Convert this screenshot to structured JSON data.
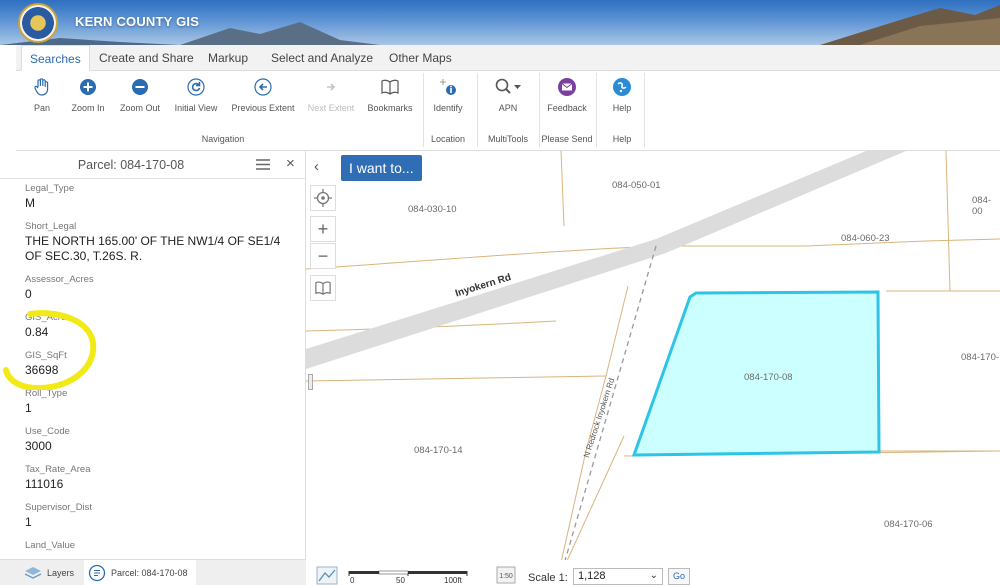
{
  "app": {
    "title": "KERN COUNTY GIS"
  },
  "tabs": [
    {
      "label": "Searches",
      "active": true
    },
    {
      "label": "Create and Share"
    },
    {
      "label": "Markup"
    },
    {
      "label": "Select and Analyze"
    },
    {
      "label": "Other Maps"
    }
  ],
  "ribbon": {
    "tools": {
      "pan": "Pan",
      "zoom_in": "Zoom In",
      "zoom_out": "Zoom Out",
      "initial_view": "Initial View",
      "previous_extent": "Previous Extent",
      "next_extent": "Next Extent",
      "bookmarks": "Bookmarks",
      "identify": "Identify",
      "apn": "APN",
      "feedback": "Feedback",
      "help": "Help"
    },
    "groups": {
      "navigation": "Navigation",
      "location": "Location",
      "multitools": "MultiTools",
      "please_send": "Please Send",
      "help": "Help"
    }
  },
  "panel": {
    "title": "Parcel: 084-170-08",
    "attributes": [
      {
        "key": "Legal_Type",
        "value": "M"
      },
      {
        "key": "Short_Legal",
        "value": "THE NORTH 165.00' OF THE NW1/4 OF SE1/4 OF SEC.30, T.26S. R."
      },
      {
        "key": "Assessor_Acres",
        "value": "0"
      },
      {
        "key": "GIS_Acres",
        "value": "0.84"
      },
      {
        "key": "GIS_SqFt",
        "value": "36698"
      },
      {
        "key": "Roll_Type",
        "value": "1"
      },
      {
        "key": "Use_Code",
        "value": "3000"
      },
      {
        "key": "Tax_Rate_Area",
        "value": "111016"
      },
      {
        "key": "Supervisor_Dist",
        "value": "1"
      },
      {
        "key": "Land_Value",
        "value": ""
      }
    ],
    "footer": {
      "layers": "Layers",
      "parcel": "Parcel: 084-170-08"
    }
  },
  "map": {
    "i_want_to": "I want to...",
    "roads": {
      "inyokern": "Inyokern Rd",
      "redrock": "N Redrock Inyokern Rd"
    },
    "parcels": {
      "p084_050_01": "084-050-01",
      "p084_030_10": "084-030-10",
      "p084_00": "084-00",
      "p084_060_23": "084-060-23",
      "p084_170_cut": "084-170-",
      "p084_170_08": "084-170-08",
      "p084_170_14": "084-170-14",
      "p084_170_06": "084-170-06"
    },
    "scalebar": {
      "t0": "0",
      "t50": "50",
      "t100": "100ft"
    },
    "scale_label": "Scale 1:",
    "scale_value": "1,128",
    "go": "Go",
    "colors": {
      "selected_fill": "#ccffff",
      "selected_stroke": "#2ec4e6",
      "parcel_line": "#d9b47c"
    }
  }
}
